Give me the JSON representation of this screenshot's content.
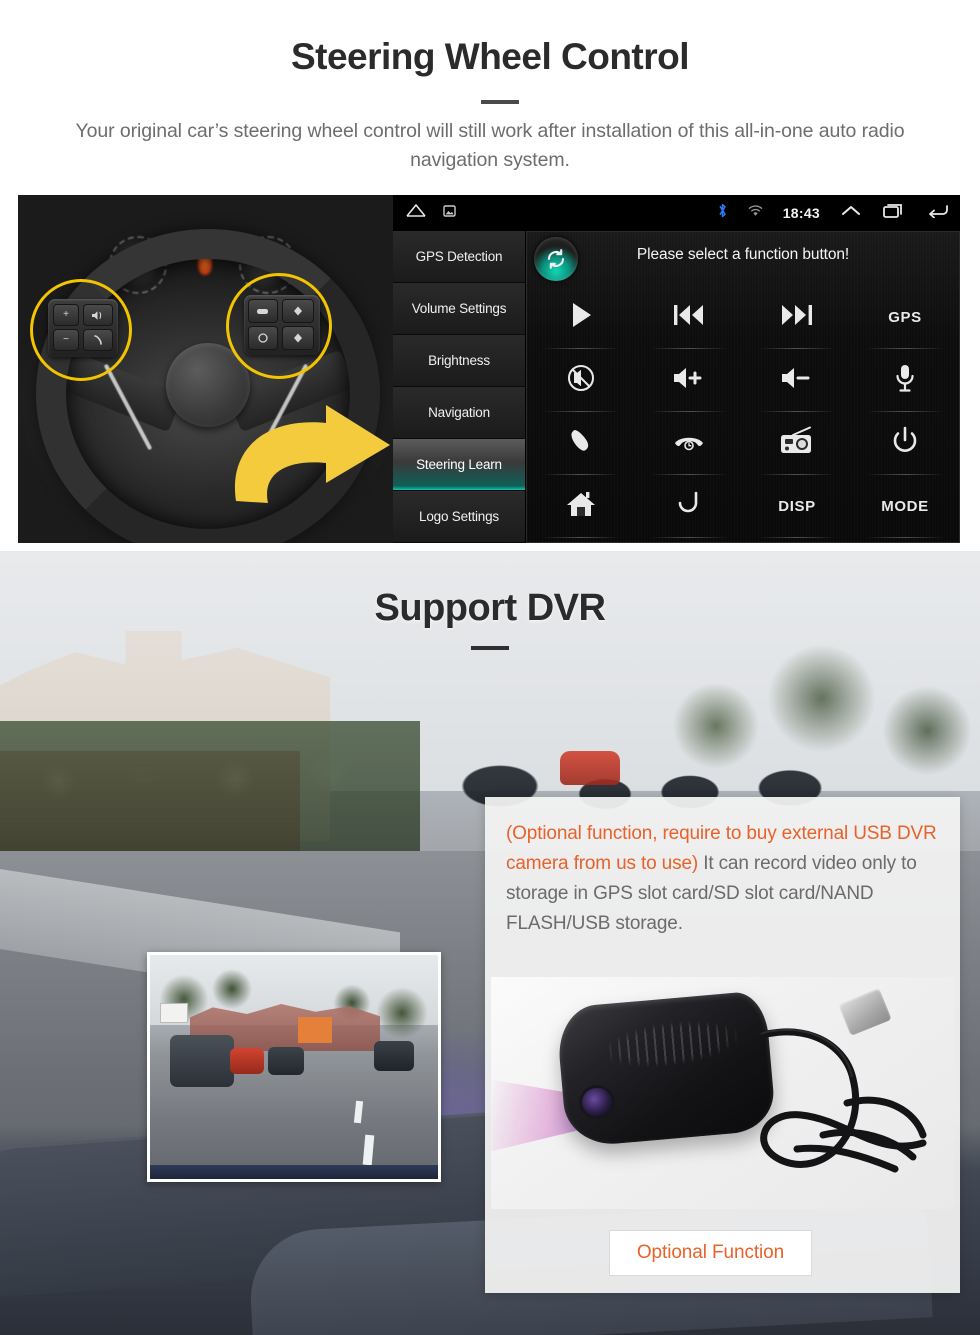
{
  "steering_section": {
    "title": "Steering Wheel Control",
    "subtitle": "Your original car’s steering wheel control will still work after installation of this all-in-one auto radio navigation system.",
    "radio": {
      "status_bar": {
        "time": "18:43",
        "icons": [
          "home-icon",
          "screenshot-icon",
          "bluetooth-icon",
          "wifi-icon",
          "collapse-up-icon",
          "recents-icon",
          "back-icon"
        ]
      },
      "sidebar": {
        "items": [
          {
            "label": "GPS Detection",
            "active": false
          },
          {
            "label": "Volume Settings",
            "active": false
          },
          {
            "label": "Brightness",
            "active": false
          },
          {
            "label": "Navigation",
            "active": false
          },
          {
            "label": "Steering Learn",
            "active": true
          },
          {
            "label": "Logo Settings",
            "active": false
          }
        ],
        "active_accent": "#11c4ae"
      },
      "prompt": "Please select a function button!",
      "sync_badge_icon": "sync-refresh-icon",
      "function_buttons": [
        {
          "label": "",
          "icon": "play-icon"
        },
        {
          "label": "",
          "icon": "previous-track-icon"
        },
        {
          "label": "",
          "icon": "next-track-icon"
        },
        {
          "label": "GPS",
          "icon": "text-label"
        },
        {
          "label": "",
          "icon": "mute-icon"
        },
        {
          "label": "",
          "icon": "volume-up-icon"
        },
        {
          "label": "",
          "icon": "volume-down-icon"
        },
        {
          "label": "",
          "icon": "microphone-icon"
        },
        {
          "label": "",
          "icon": "call-answer-icon"
        },
        {
          "label": "",
          "icon": "call-end-icon"
        },
        {
          "label": "",
          "icon": "radio-icon"
        },
        {
          "label": "",
          "icon": "power-icon"
        },
        {
          "label": "",
          "icon": "home-icon"
        },
        {
          "label": "",
          "icon": "back-return-icon"
        },
        {
          "label": "DISP",
          "icon": "text-label"
        },
        {
          "label": "MODE",
          "icon": "text-label"
        }
      ]
    },
    "photo_annotations": {
      "left_highlight": "yellow-circle-highlight",
      "right_highlight": "yellow-circle-highlight",
      "arrow": "yellow-right-arrow",
      "highlight_color": "#f2c500"
    }
  },
  "dvr_section": {
    "title": "Support DVR",
    "info_highlight": "(Optional function, require to buy external USB DVR camera from us to use)",
    "info_body": "It can record video only to storage in GPS slot card/SD slot card/NAND FLASH/USB storage.",
    "button_label": "Optional Function",
    "highlight_color": "#e8622a",
    "inset_name": "dashcam-video-preview",
    "product_name": "usb-dvr-camera-photo"
  }
}
